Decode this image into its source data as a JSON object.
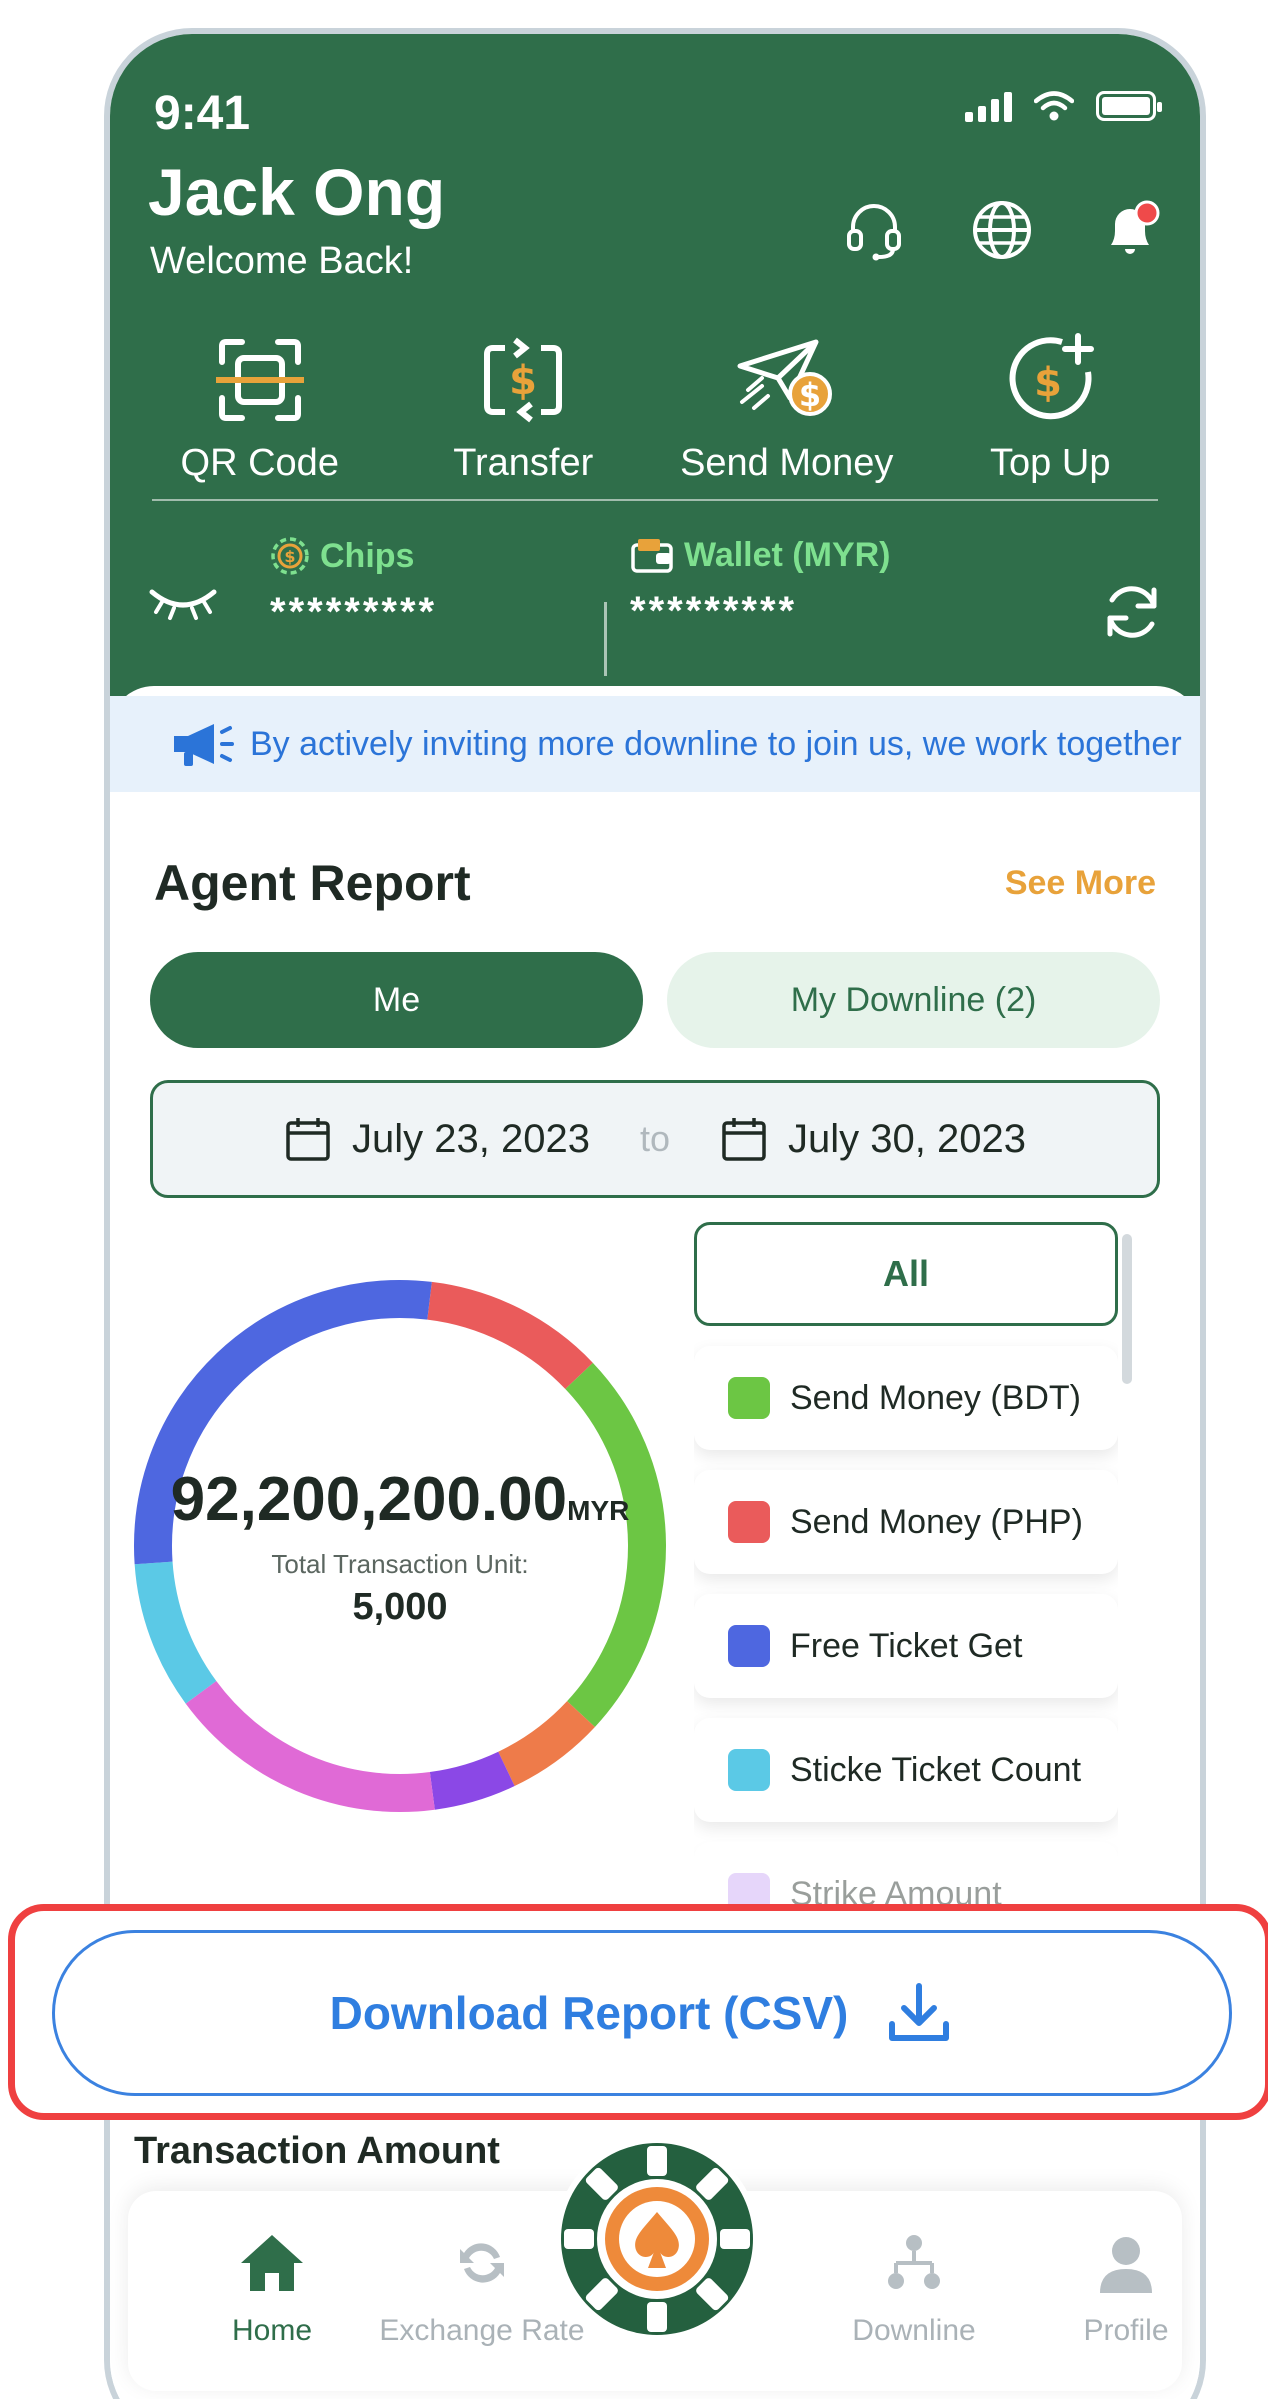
{
  "status_bar": {
    "time": "9:41"
  },
  "header": {
    "user_name": "Jack Ong",
    "welcome": "Welcome Back!",
    "icons": [
      "headset-icon",
      "globe-icon",
      "bell-icon"
    ]
  },
  "quick_actions": [
    {
      "label": "QR Code",
      "icon": "qr-scan-icon"
    },
    {
      "label": "Transfer",
      "icon": "transfer-icon"
    },
    {
      "label": "Send Money",
      "icon": "send-money-icon"
    },
    {
      "label": "Top Up",
      "icon": "top-up-icon"
    }
  ],
  "balances": {
    "chips": {
      "label": "Chips",
      "value": "*********"
    },
    "wallet": {
      "label": "Wallet (MYR)",
      "value": "*********"
    }
  },
  "announcement": "By actively inviting more downline to join us, we work together",
  "report": {
    "title": "Agent Report",
    "see_more": "See More",
    "tabs": [
      "Me",
      "My Downline (2)"
    ],
    "date_from": "July 23, 2023",
    "date_to_word": "to",
    "date_to": "July 30, 2023",
    "total_value": "92,200,200.00",
    "total_unit": "MYR",
    "transaction_unit_label": "Total Transaction Unit:",
    "transaction_unit_value": "5,000",
    "legend_all": "All",
    "legend": [
      {
        "label": "Send Money (BDT)",
        "color": "#6cc644"
      },
      {
        "label": "Send Money (PHP)",
        "color": "#ea5b5b"
      },
      {
        "label": "Free Ticket Get",
        "color": "#4e67e0"
      },
      {
        "label": "Sticke Ticket Count",
        "color": "#5bc9e6"
      },
      {
        "label": "Strike Amount",
        "color": "#c8a6f4"
      }
    ]
  },
  "chart_data": {
    "type": "pie",
    "categories": [
      "Send Money (PHP)",
      "Send Money (BDT)",
      "Orange segment",
      "Purple segment",
      "Magenta segment",
      "Sticke Ticket Count",
      "Free Ticket Get"
    ],
    "values": [
      11,
      24,
      6,
      5,
      17,
      9,
      28
    ],
    "colors": [
      "#ea5b5b",
      "#6cc644",
      "#ee7b4a",
      "#8b48e6",
      "#e06ad6",
      "#5bc9e6",
      "#4e67e0"
    ]
  },
  "download": {
    "label": "Download Report (CSV)"
  },
  "transaction_amount_title": "Transaction Amount",
  "nav": [
    {
      "label": "Home",
      "active": true
    },
    {
      "label": "Exchange Rate",
      "active": false
    },
    {
      "label": "Downline",
      "active": false
    },
    {
      "label": "Profile",
      "active": false
    }
  ]
}
